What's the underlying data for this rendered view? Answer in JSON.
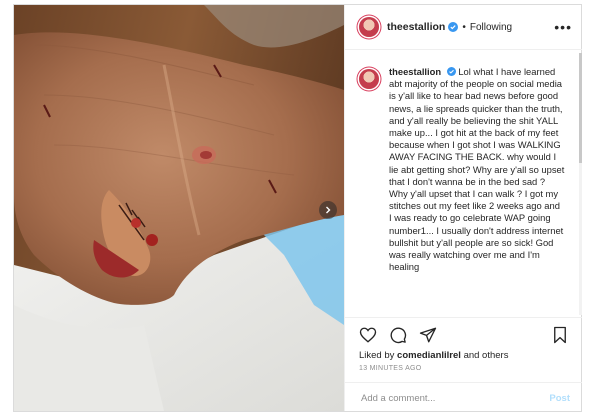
{
  "header": {
    "username": "theestallion",
    "separator": "•",
    "follow_status": "Following",
    "more_icon": "more-horizontal-icon"
  },
  "caption": {
    "username": "theestallion",
    "text": "Lol what I have learned abt majority of the people on social media is y'all like to hear bad news before good news, a lie spreads quicker than the truth, and y'all really be believing the shit YALL make up... I got hit at the back of my feet because when I got shot I was WALKING AWAY FACING THE BACK. why would I lie abt getting shot? Why are y'all so upset that I don't wanna be in the bed sad ? Why y'all upset that I can walk ? I got my stitches out my feet like 2 weeks ago and I was ready to go celebrate WAP going number1... I usually don't address internet bullshit but y'all people are so sick! God was really watching over me and I'm healing"
  },
  "actions": {
    "icons": [
      "heart-icon",
      "comment-icon",
      "share-icon",
      "bookmark-icon"
    ]
  },
  "likes": {
    "prefix": "Liked by",
    "user": "comedianlilrel",
    "suffix": "and others"
  },
  "timestamp": "13 MINUTES AGO",
  "add_comment": {
    "placeholder": "Add a comment...",
    "post_label": "Post"
  },
  "colors": {
    "verified": "#3897f0",
    "post_disabled": "#b2dffc",
    "border": "#dbdbdb"
  }
}
